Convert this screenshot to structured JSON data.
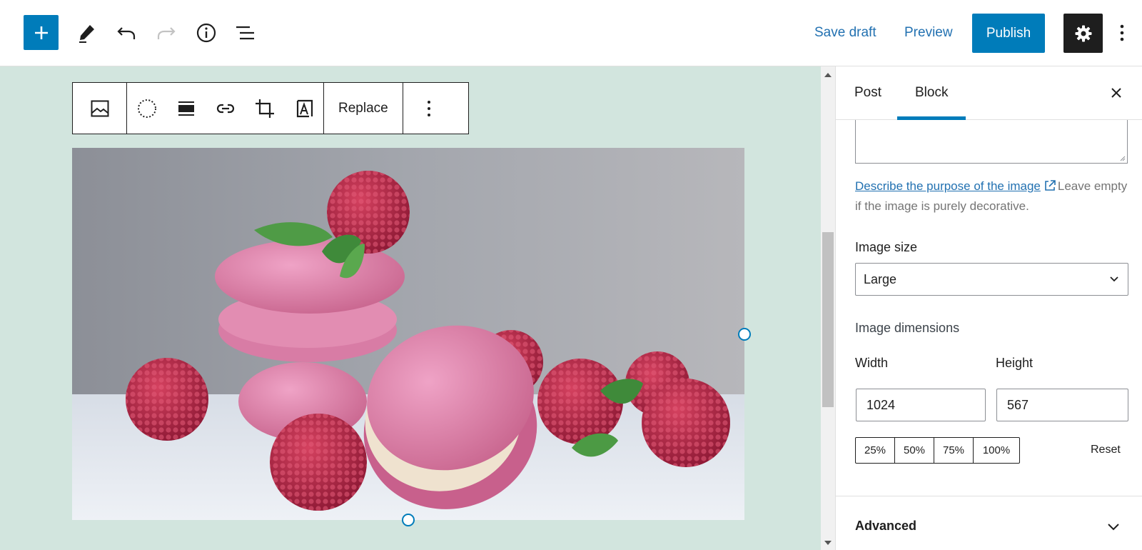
{
  "header": {
    "save_draft": "Save draft",
    "preview": "Preview",
    "publish": "Publish",
    "icons": [
      "plus-icon",
      "pencil-icon",
      "undo-icon",
      "redo-icon",
      "info-icon",
      "list-view-icon",
      "gear-icon",
      "more-vertical-icon"
    ]
  },
  "block_toolbar": {
    "icons": [
      "image-icon",
      "duotone-icon",
      "align-icon",
      "link-icon",
      "crop-icon",
      "text-overlay-icon",
      "more-vertical-icon"
    ],
    "replace_label": "Replace"
  },
  "sidebar": {
    "tabs": [
      {
        "label": "Post",
        "active": false
      },
      {
        "label": "Block",
        "active": true
      }
    ],
    "alt_help": {
      "link_text": "Describe the purpose of the image",
      "text": "Leave empty if the image is purely decorative."
    },
    "image_size": {
      "label": "Image size",
      "value": "Large"
    },
    "dimensions": {
      "label": "Image dimensions",
      "width_label": "Width",
      "width_value": "1024",
      "height_label": "Height",
      "height_value": "567",
      "presets": [
        "25%",
        "50%",
        "75%",
        "100%"
      ],
      "reset_label": "Reset"
    },
    "advanced_label": "Advanced"
  },
  "colors": {
    "accent": "#007cba",
    "canvas_bg": "#d2e5de",
    "dark": "#1e1e1e"
  }
}
